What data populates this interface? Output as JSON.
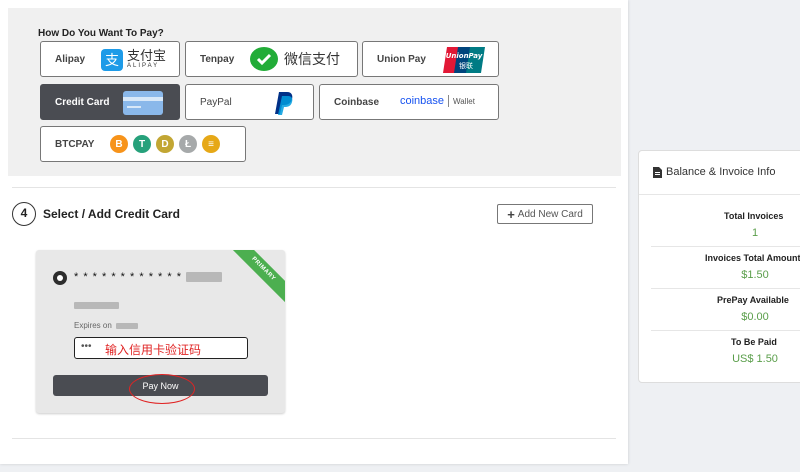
{
  "payment": {
    "title": "How Do You Want To Pay?",
    "methods": [
      {
        "label": "Alipay",
        "logo_text": "支付宝",
        "logo_sub": "ALIPAY",
        "icon": "alipay-icon"
      },
      {
        "label": "Tenpay",
        "logo_text": "微信支付",
        "icon": "wechat-pay-icon"
      },
      {
        "label": "Union Pay",
        "logo_text": "UnionPay",
        "logo_sub": "银联",
        "icon": "unionpay-icon"
      },
      {
        "label": "Credit Card",
        "icon": "credit-card-icon",
        "selected": true
      },
      {
        "label": "PayPal",
        "icon": "paypal-icon"
      },
      {
        "label": "Coinbase",
        "logo_text": "coinbase",
        "logo_sub": "Wallet",
        "icon": "coinbase-icon"
      },
      {
        "label": "BTCPAY",
        "icon": "crypto-coins-icon",
        "coins": [
          "B",
          "T",
          "D",
          "Ł",
          "≡"
        ]
      }
    ]
  },
  "step": {
    "number": "4",
    "title": "Select / Add Credit Card",
    "add_button": "Add New Card"
  },
  "card": {
    "ribbon": "PRIMARY",
    "number": "* * * * * * * * * * * *",
    "expires_label": "Expires on",
    "cvv_dots": "•••",
    "cvv_note": "输入信用卡验证码",
    "pay_button": "Pay Now"
  },
  "balance": {
    "header": "Balance & Invoice Info",
    "stats": [
      {
        "label": "Total Invoices",
        "value": "1"
      },
      {
        "label": "Invoices Total Amount",
        "value": "$1.50"
      },
      {
        "label": "PrePay Available",
        "value": "$0.00"
      },
      {
        "label": "To Be Paid",
        "value": "US$ 1.50"
      }
    ]
  },
  "colors": {
    "accent_green": "#5a9e4a",
    "selected_dark": "#4a4c52",
    "annotation_red": "#e02424"
  }
}
